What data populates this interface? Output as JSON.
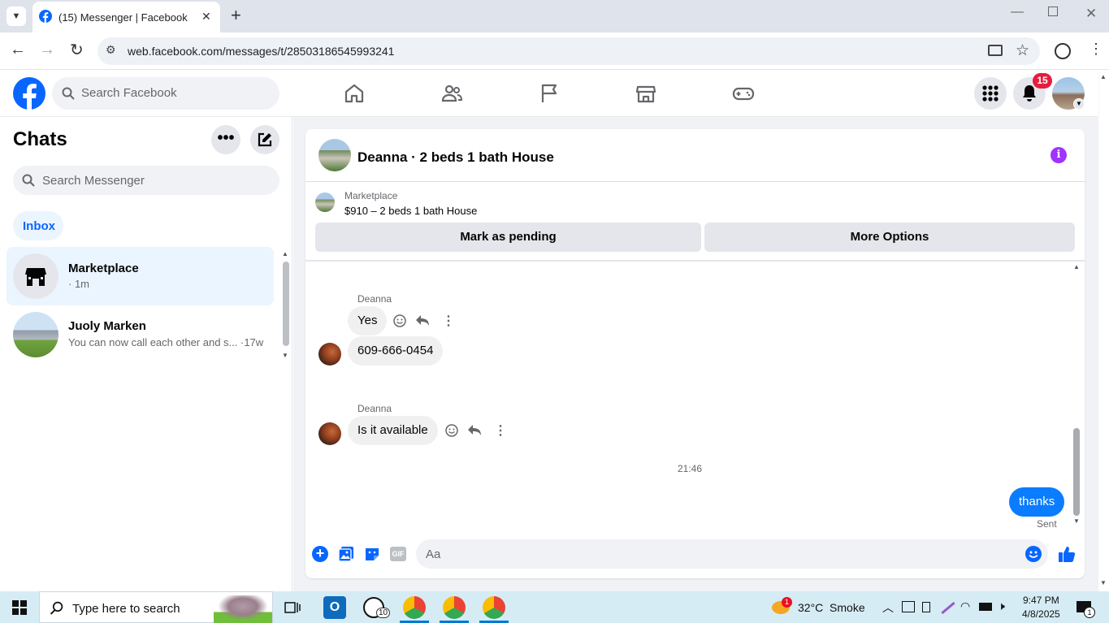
{
  "browser": {
    "tab_title": "(15) Messenger | Facebook",
    "url": "web.facebook.com/messages/t/28503186545993241",
    "tab_close": "✕",
    "new_tab": "+"
  },
  "header": {
    "search_placeholder": "Search Facebook",
    "notification_count": "15"
  },
  "sidebar": {
    "title": "Chats",
    "search_placeholder": "Search Messenger",
    "filter_label": "Inbox",
    "chats": [
      {
        "name": "Marketplace",
        "preview": "· 1m"
      },
      {
        "name": "Juoly Marken",
        "preview": "You can now call each other and s... ·17w"
      }
    ]
  },
  "conversation": {
    "title": "Deanna · 2 beds 1 bath House",
    "listing_source": "Marketplace",
    "listing_title": "$910 – 2 beds 1 bath House",
    "mark_pending_label": "Mark as pending",
    "more_options_label": "More Options",
    "messages": [
      {
        "sender": "Deanna",
        "text": "Yes"
      },
      {
        "sender": "",
        "text": "609-666-0454"
      },
      {
        "sender": "Deanna",
        "text": "Is it available"
      }
    ],
    "timestamp": "21:46",
    "outgoing": {
      "text": "thanks",
      "status": "Sent"
    },
    "composer_placeholder": "Aa",
    "gif_label": "GIF"
  },
  "taskbar": {
    "search_placeholder": "Type here to search",
    "whatsapp_badge": "10",
    "weather": "32°C  Smoke",
    "weather_badge": "1",
    "time": "9:47 PM",
    "date": "4/8/2025",
    "notif_count": "1"
  },
  "colors": {
    "brand": "#0866ff",
    "messenger_accent": "#0a7cff",
    "badge_red": "#e41e3f",
    "purple_info": "#a033ff"
  }
}
